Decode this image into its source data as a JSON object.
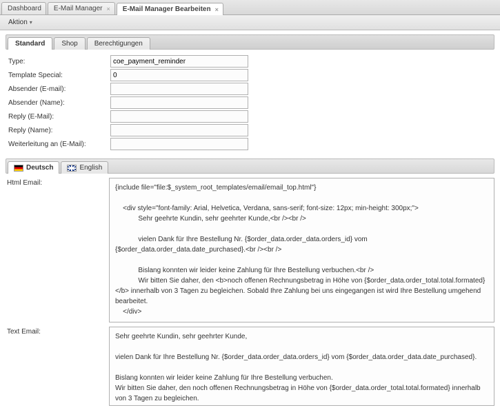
{
  "topTabs": {
    "dashboard": "Dashboard",
    "emailManager": "E-Mail Manager",
    "emailManagerEdit": "E-Mail Manager Bearbeiten"
  },
  "toolbar": {
    "aktion": "Aktion"
  },
  "subTabs": {
    "standard": "Standard",
    "shop": "Shop",
    "berechtigungen": "Berechtigungen"
  },
  "form": {
    "typeLabel": "Type:",
    "typeValue": "coe_payment_reminder",
    "templateSpecialLabel": "Template Special:",
    "templateSpecialValue": "0",
    "absenderEmailLabel": "Absender (E-mail):",
    "absenderEmailValue": "",
    "absenderNameLabel": "Absender (Name):",
    "absenderNameValue": "",
    "replyEmailLabel": "Reply (E-Mail):",
    "replyEmailValue": "",
    "replyNameLabel": "Reply (Name):",
    "replyNameValue": "",
    "weiterleitungLabel": "Weiterleitung an (E-Mail):",
    "weiterleitungValue": ""
  },
  "langTabs": {
    "deutsch": "Deutsch",
    "english": "English"
  },
  "htmlEmailLabel": "Html Email:",
  "htmlEmailContent": "{include file=\"file:$_system_root_templates/email/email_top.html\"}\n\n    <div style=\"font-family: Arial, Helvetica, Verdana, sans-serif; font-size: 12px; min-height: 300px;\">\n            Sehr geehrte Kundin, sehr geehrter Kunde,<br /><br />\n\n            vielen Dank für Ihre Bestellung Nr. {$order_data.order_data.orders_id} vom {$order_data.order_data.date_purchased}.<br /><br />\n\n            Bislang konnten wir leider keine Zahlung für Ihre Bestellung verbuchen.<br />\n            Wir bitten Sie daher, den <b>noch offenen Rechnungsbetrag in Höhe von {$order_data.order_total.total.formated}</b> innerhalb von 3 Tagen zu begleichen. Sobald Ihre Zahlung bei uns eingegangen ist wird Ihre Bestellung umgehend bearbeitet.\n    </div>\n\n<!-- // End Content \\\\ -->\n{include file=\"file:$_system_root_templates/email/email_bottom.html\"}",
  "textEmailLabel": "Text Email:",
  "textEmailContent": "Sehr geehrte Kundin, sehr geehrter Kunde,\n\nvielen Dank für Ihre Bestellung Nr. {$order_data.order_data.orders_id} vom {$order_data.order_data.date_purchased}.\n\nBislang konnten wir leider keine Zahlung für Ihre Bestellung verbuchen.\nWir bitten Sie daher, den noch offenen Rechnungsbetrag in Höhe von {$order_data.order_total.total.formated} innerhalb von 3 Tagen zu begleichen.\nSobald Ihre Zahlung bei uns eingegangen ist wird Ihre Bestellung umgehend bearbeitet.\n\n\n{$_system_footer_txt}"
}
